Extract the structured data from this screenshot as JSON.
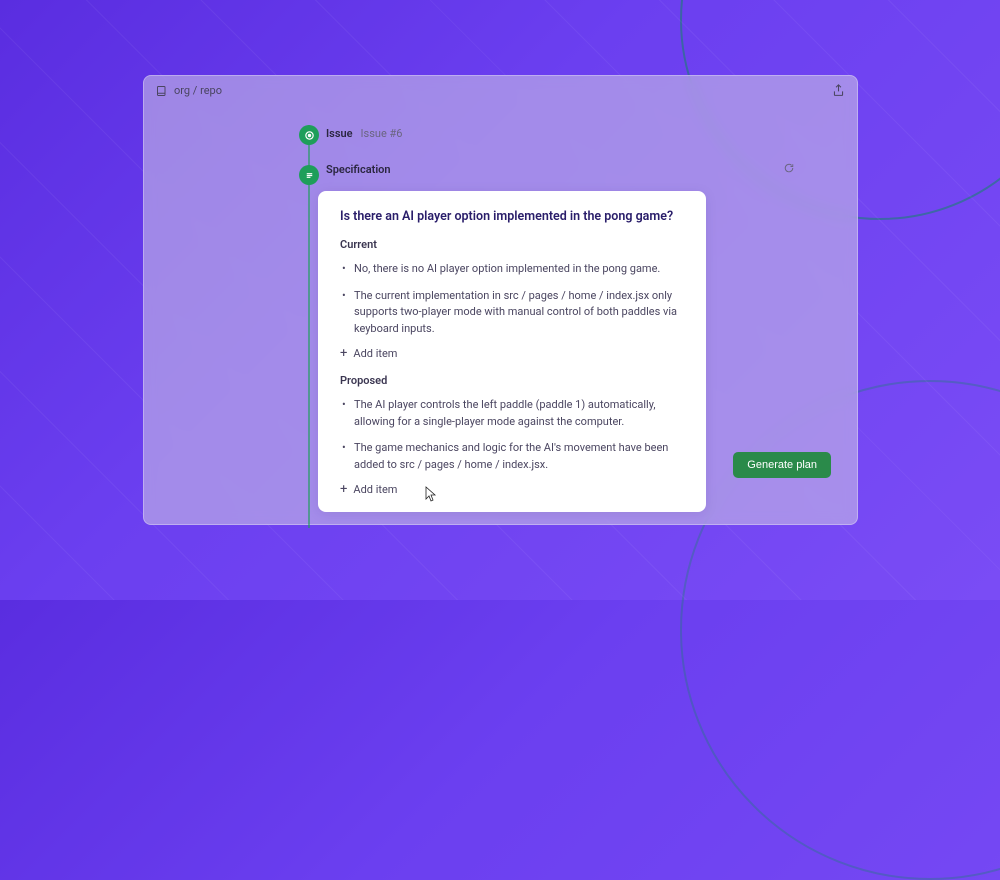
{
  "header": {
    "repo_path": "org / repo"
  },
  "timeline": {
    "issue": {
      "label": "Issue",
      "ref": "Issue #6"
    },
    "spec": {
      "label": "Specification"
    }
  },
  "card": {
    "title": "Is there an AI player option implemented in the pong game?",
    "current": {
      "label": "Current",
      "items": [
        "No, there is no AI player option implemented in the pong game.",
        "The current implementation in src / pages / home / index.jsx only supports two-player mode with manual control of both paddles via keyboard inputs."
      ],
      "add_label": "Add item"
    },
    "proposed": {
      "label": "Proposed",
      "items": [
        "The AI player controls the left paddle (paddle 1) automatically, allowing for a single-player mode against the computer.",
        "The game mechanics and logic for the AI's movement have been added to src / pages / home / index.jsx."
      ],
      "add_label": "Add item"
    }
  },
  "actions": {
    "generate_plan": "Generate plan"
  }
}
